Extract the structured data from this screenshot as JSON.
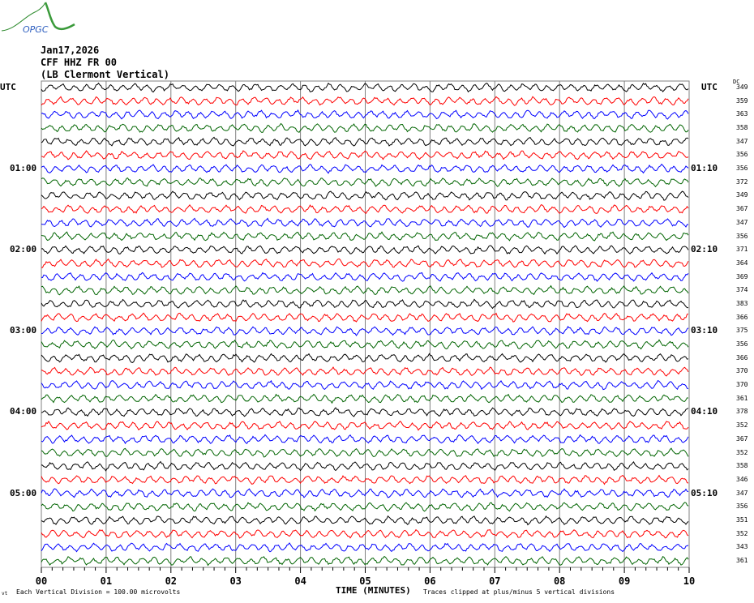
{
  "logo": {
    "text": "OPGC"
  },
  "header": {
    "date": "Jan17,2026",
    "channel": "CFF HHZ FR 00",
    "location": "(LB  Clermont Vertical)"
  },
  "chart_data": {
    "type": "line",
    "title": "CFF HHZ FR 00 helicorder",
    "xlabel": "TIME (MINUTES)",
    "x_ticks": [
      "00",
      "01",
      "02",
      "03",
      "04",
      "05",
      "06",
      "07",
      "08",
      "09",
      "10"
    ],
    "xlim": [
      0,
      10
    ],
    "left_axis_label": "UTC",
    "right_axis_label": "UTC",
    "dc_label": "DC",
    "left_time_labels": [
      {
        "trace": 0,
        "text": "UTC"
      },
      {
        "trace": 6,
        "text": "01:00"
      },
      {
        "trace": 12,
        "text": "02:00"
      },
      {
        "trace": 18,
        "text": "03:00"
      },
      {
        "trace": 24,
        "text": "04:00"
      },
      {
        "trace": 30,
        "text": "05:00"
      }
    ],
    "right_time_labels": [
      {
        "trace": 0,
        "text": "UTC"
      },
      {
        "trace": 6,
        "text": "01:10"
      },
      {
        "trace": 12,
        "text": "02:10"
      },
      {
        "trace": 18,
        "text": "03:10"
      },
      {
        "trace": 24,
        "text": "04:10"
      },
      {
        "trace": 30,
        "text": "05:10"
      }
    ],
    "trace_colors": [
      "#000000",
      "#ff0000",
      "#0000ff",
      "#006400"
    ],
    "dc_offsets": [
      349,
      359,
      363,
      358,
      347,
      356,
      356,
      372,
      349,
      367,
      347,
      356,
      371,
      364,
      369,
      374,
      383,
      366,
      375,
      356,
      366,
      370,
      370,
      361,
      378,
      352,
      367,
      352,
      358,
      346,
      347,
      356,
      351,
      352,
      343,
      361
    ],
    "footer_left": "Each Vertical Division =  100.00 microvolts",
    "footer_right": "Traces clipped at plus/minus 5 vertical divisions",
    "corner_mark": "vt"
  }
}
